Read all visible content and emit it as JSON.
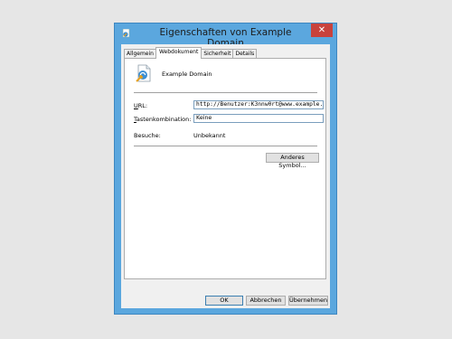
{
  "window": {
    "title": "Eigenschaften von Example Domain",
    "close_glyph": "✕"
  },
  "tabs": [
    {
      "label": "Allgemein",
      "active": false
    },
    {
      "label": "Webdokument",
      "active": true
    },
    {
      "label": "Sicherheit",
      "active": false
    },
    {
      "label": "Details",
      "active": false
    }
  ],
  "panel": {
    "page_title": "Example Domain",
    "url_label": "URL:",
    "url_value": "http://Benutzer:K3nnw0rt@www.example.c",
    "shortcut_label": "Tastenkombination:",
    "shortcut_value": "Keine",
    "visits_label": "Besuche:",
    "visits_value": "Unbekannt",
    "change_icon_button": "Anderes Symbol..."
  },
  "footer": {
    "ok": "OK",
    "cancel": "Abbrechen",
    "apply": "Übernehmen"
  },
  "icons": {
    "app": "internet-shortcut-icon",
    "page": "internet-shortcut-icon"
  },
  "colors": {
    "titlebar": "#5ba7de",
    "close": "#c8423c",
    "dialog_bg": "#f0f0f0"
  }
}
